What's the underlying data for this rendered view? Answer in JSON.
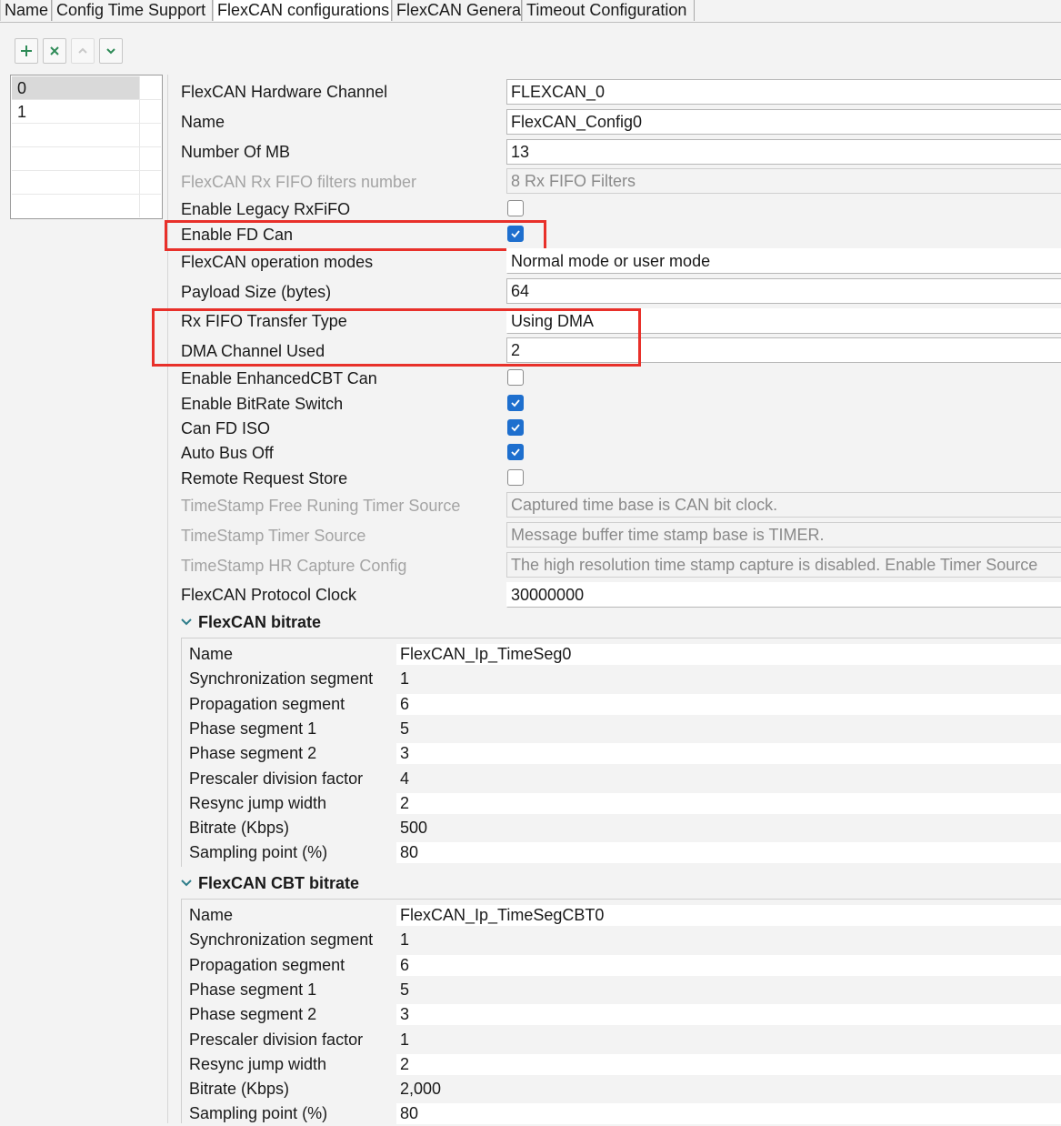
{
  "tabs": [
    {
      "label": "Name",
      "active": false
    },
    {
      "label": "Config Time Support",
      "active": false
    },
    {
      "label": "FlexCAN configurations",
      "active": true
    },
    {
      "label": "FlexCAN General",
      "active": false
    },
    {
      "label": "Timeout Configuration",
      "active": false
    }
  ],
  "toolbar": {
    "add": "add-icon",
    "remove": "remove-icon",
    "move_up": "chevron-up-icon",
    "move_down": "chevron-down-icon"
  },
  "list": {
    "items": [
      "0",
      "1"
    ],
    "selected": "0"
  },
  "properties": {
    "hardware_channel": {
      "label": "FlexCAN Hardware Channel",
      "value": "FLEXCAN_0"
    },
    "name": {
      "label": "Name",
      "value": "FlexCAN_Config0"
    },
    "number_of_mb": {
      "label": "Number Of MB",
      "value": "13"
    },
    "rx_fifo_filters": {
      "label": "FlexCAN Rx FIFO filters number",
      "value": "8 Rx FIFO Filters"
    },
    "legacy_rxfifo": {
      "label": "Enable Legacy RxFiFO",
      "checked": false
    },
    "fd_can": {
      "label": "Enable FD Can",
      "checked": true
    },
    "operation_modes": {
      "label": "FlexCAN operation modes",
      "value": "Normal mode or user mode"
    },
    "payload_size": {
      "label": "Payload Size (bytes)",
      "value": "64"
    },
    "rx_fifo_transfer": {
      "label": "Rx FIFO Transfer Type",
      "value": "Using DMA"
    },
    "dma_channel": {
      "label": "DMA Channel Used",
      "value": "2"
    },
    "enhanced_cbt": {
      "label": "Enable EnhancedCBT Can",
      "checked": false
    },
    "bitrate_switch": {
      "label": "Enable BitRate Switch",
      "checked": true
    },
    "fd_iso": {
      "label": "Can FD ISO",
      "checked": true
    },
    "auto_bus_off": {
      "label": "Auto Bus Off",
      "checked": true
    },
    "remote_request_store": {
      "label": "Remote Request Store",
      "checked": false
    },
    "ts_free_timer": {
      "label": "TimeStamp Free Runing Timer Source",
      "value": "Captured time base is CAN bit clock."
    },
    "ts_timer_source": {
      "label": "TimeStamp Timer Source",
      "value": "Message buffer time stamp base is TIMER."
    },
    "ts_hr_capture": {
      "label": "TimeStamp HR Capture Config",
      "value": "The high resolution time stamp capture is disabled. Enable Timer Source"
    },
    "protocol_clock": {
      "label": "FlexCAN Protocol Clock",
      "value": "30000000"
    }
  },
  "bitrate": {
    "title": "FlexCAN bitrate",
    "rows": [
      {
        "key": "Name",
        "value": "FlexCAN_Ip_TimeSeg0"
      },
      {
        "key": "Synchronization segment",
        "value": "1"
      },
      {
        "key": "Propagation segment",
        "value": "6"
      },
      {
        "key": "Phase segment 1",
        "value": "5"
      },
      {
        "key": "Phase segment 2",
        "value": "3"
      },
      {
        "key": "Prescaler division factor",
        "value": "4"
      },
      {
        "key": "Resync jump width",
        "value": "2"
      },
      {
        "key": "Bitrate (Kbps)",
        "value": "500"
      },
      {
        "key": "Sampling point (%)",
        "value": "80"
      }
    ]
  },
  "cbt_bitrate": {
    "title": "FlexCAN CBT bitrate",
    "rows": [
      {
        "key": "Name",
        "value": "FlexCAN_Ip_TimeSegCBT0"
      },
      {
        "key": "Synchronization segment",
        "value": "1"
      },
      {
        "key": "Propagation segment",
        "value": "6"
      },
      {
        "key": "Phase segment 1",
        "value": "5"
      },
      {
        "key": "Phase segment 2",
        "value": "3"
      },
      {
        "key": "Prescaler division factor",
        "value": "1"
      },
      {
        "key": "Resync jump width",
        "value": "2"
      },
      {
        "key": "Bitrate (Kbps)",
        "value": "2,000"
      },
      {
        "key": "Sampling point (%)",
        "value": "80"
      }
    ]
  },
  "colors": {
    "checkbox_on": "#1e6fce",
    "highlight": "#e8302a",
    "toolbar_icon": "#2e8b57"
  }
}
